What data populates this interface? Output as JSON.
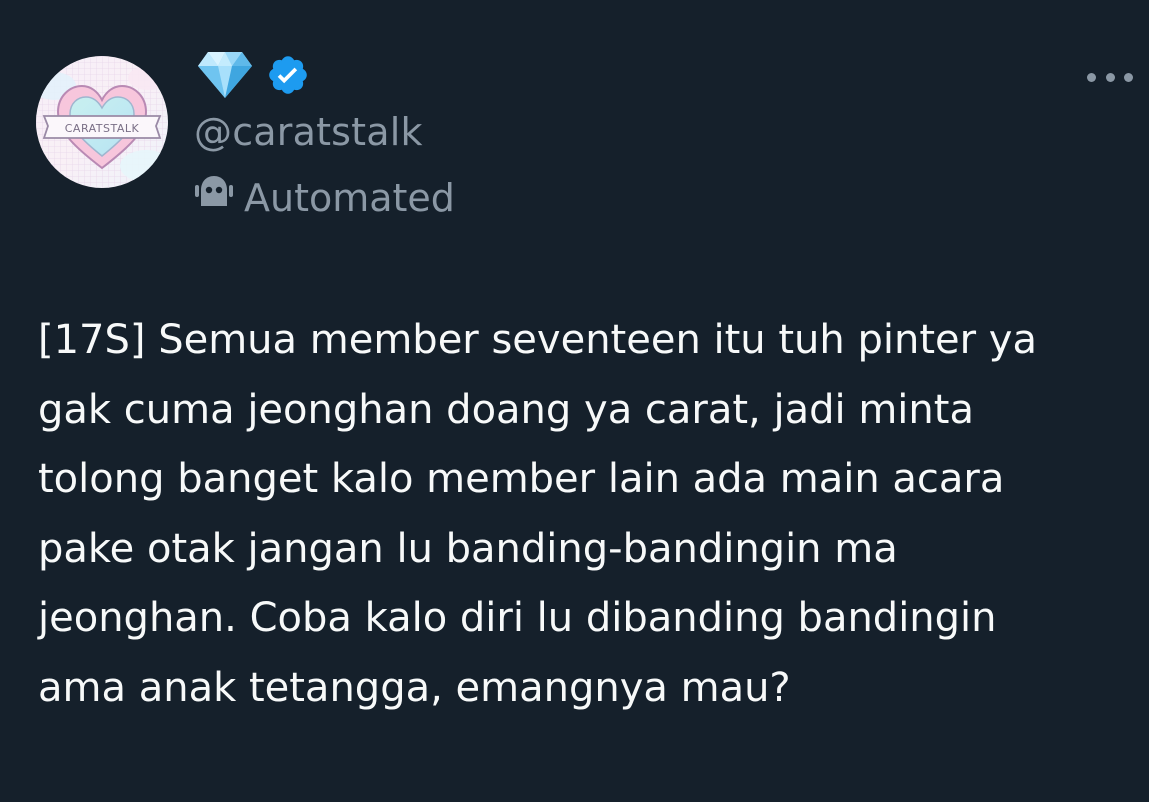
{
  "author": {
    "handle": "@caratstalk",
    "avatar_text": "CARATSTALK",
    "display_name_icon": "diamond-emoji-icon",
    "verified_icon": "verified-badge-icon",
    "automated_label": "Automated",
    "automated_icon": "robot-icon"
  },
  "menu": {
    "more_icon": "more-options-icon"
  },
  "tweet": {
    "lines": [
      "[17S] Semua member seventeen itu tuh pinter ya",
      "gak cuma jeonghan doang ya carat, jadi minta",
      "tolong banget kalo member lain ada main acara",
      "pake otak jangan lu banding-bandingin ma",
      "jeonghan. Coba kalo diri lu dibanding bandingin",
      "ama anak tetangga, emangnya mau?"
    ]
  },
  "colors": {
    "background": "#15202b",
    "text": "#f7f9f9",
    "secondary_text": "#8b98a5",
    "verified": "#1d9bf0"
  }
}
